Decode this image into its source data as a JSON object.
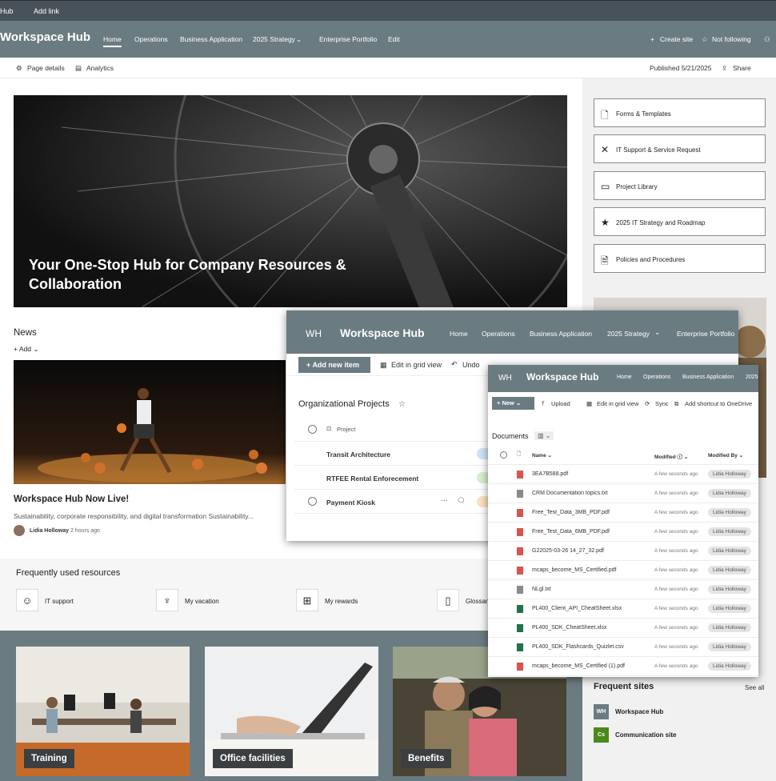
{
  "topbar": {
    "hub": "Hub",
    "add_link": "Add link"
  },
  "header": {
    "title": "Workspace Hub",
    "nav": [
      "Home",
      "Operations",
      "Business Application",
      "2025 Strategy",
      "Enterprise Portfolio",
      "Edit"
    ],
    "new_site": "Create site",
    "follow": "Not following"
  },
  "cmdbar": {
    "page_details": "Page details",
    "analytics": "Analytics",
    "published": "Published 5/21/2025",
    "share": "Share"
  },
  "hero": {
    "caption": "Your One-Stop Hub for Company Resources & Collaboration"
  },
  "news": {
    "heading": "News",
    "add": "Add",
    "title": "Workspace Hub Now Live!",
    "desc": "Sustainability, corporate responsibility, and digital transformation Sustainability...",
    "author": "Lidia Holloway",
    "time": "2 hours ago"
  },
  "quick_links": [
    {
      "label": "Forms & Templates",
      "icon": "form-icon"
    },
    {
      "label": "IT Support & Service Request",
      "icon": "tools-icon"
    },
    {
      "label": "Project Library",
      "icon": "folder-icon"
    },
    {
      "label": "2025 IT Strategy and Roadmap",
      "icon": "star-icon"
    },
    {
      "label": "Policies and Procedures",
      "icon": "document-icon"
    }
  ],
  "frequent": {
    "heading": "Frequently used resources",
    "items": [
      {
        "label": "IT support",
        "icon": "person-icon"
      },
      {
        "label": "My vacation",
        "icon": "palm-icon"
      },
      {
        "label": "My rewards",
        "icon": "gift-icon"
      },
      {
        "label": "Glossary",
        "icon": "book-icon"
      }
    ]
  },
  "tiles": [
    {
      "label": "Training"
    },
    {
      "label": "Office facilities"
    },
    {
      "label": "Benefits"
    }
  ],
  "frequent_sites": {
    "heading": "Frequent sites",
    "see_all": "See all",
    "items": [
      {
        "label": "Workspace Hub",
        "abbr": "WH",
        "color": "#6b7b82"
      },
      {
        "label": "Communication site",
        "abbr": "Cs",
        "color": "#4a8a1c"
      }
    ]
  },
  "list_window": {
    "avatar": "WH",
    "title": "Workspace Hub",
    "nav": [
      "Home",
      "Operations",
      "Business Application",
      "2025 Strategy",
      "Enterprise Portfolio"
    ],
    "cmd": {
      "add": "Add new item",
      "grid": "Edit in grid view",
      "undo": "Undo"
    },
    "list_title": "Organizational Projects",
    "col_project": "Project",
    "rows": [
      "Transit Architecture",
      "RTFEE Rental Enforecement",
      "Payment Kiosk"
    ],
    "status_colors": [
      "#cfe4f7",
      "#d6f0d0",
      "#fbe3c2"
    ]
  },
  "docs_window": {
    "avatar": "WH",
    "title": "Workspace Hub",
    "nav": [
      "Home",
      "Operations",
      "Business Application",
      "2025"
    ],
    "cmd": {
      "new": "New",
      "upload": "Upload",
      "grid": "Edit in grid view",
      "sync": "Sync",
      "shortcut": "Add shortcut to OneDrive"
    },
    "library": "Documents",
    "cols": {
      "name": "Name",
      "modified": "Modified",
      "modified_by": "Modified By"
    },
    "files": [
      {
        "name": "3EA7B588.pdf",
        "type": "pdf"
      },
      {
        "name": "CRM Documentation topics.txt",
        "type": "txt"
      },
      {
        "name": "Free_Test_Data_3MB_PDF.pdf",
        "type": "pdf"
      },
      {
        "name": "Free_Test_Data_6MB_PDF.pdf",
        "type": "pdf"
      },
      {
        "name": "G22025-03-26 14_27_32.pdf",
        "type": "pdf"
      },
      {
        "name": "mcaps_become_MS_Certified.pdf",
        "type": "pdf"
      },
      {
        "name": "NLgl.txt",
        "type": "txt"
      },
      {
        "name": "PL400_Client_API_CheatSheet.xlsx",
        "type": "xlsx"
      },
      {
        "name": "PL400_SDK_CheatSheet.xlsx",
        "type": "xlsx"
      },
      {
        "name": "PL400_SDK_Flashcards_Quizlet.csv",
        "type": "xlsx"
      },
      {
        "name": "mcaps_become_MS_Certified (1).pdf",
        "type": "pdf"
      }
    ],
    "modified": "A few seconds ago",
    "modified_by": "Lidia Holloway"
  },
  "side_see_all": "all"
}
